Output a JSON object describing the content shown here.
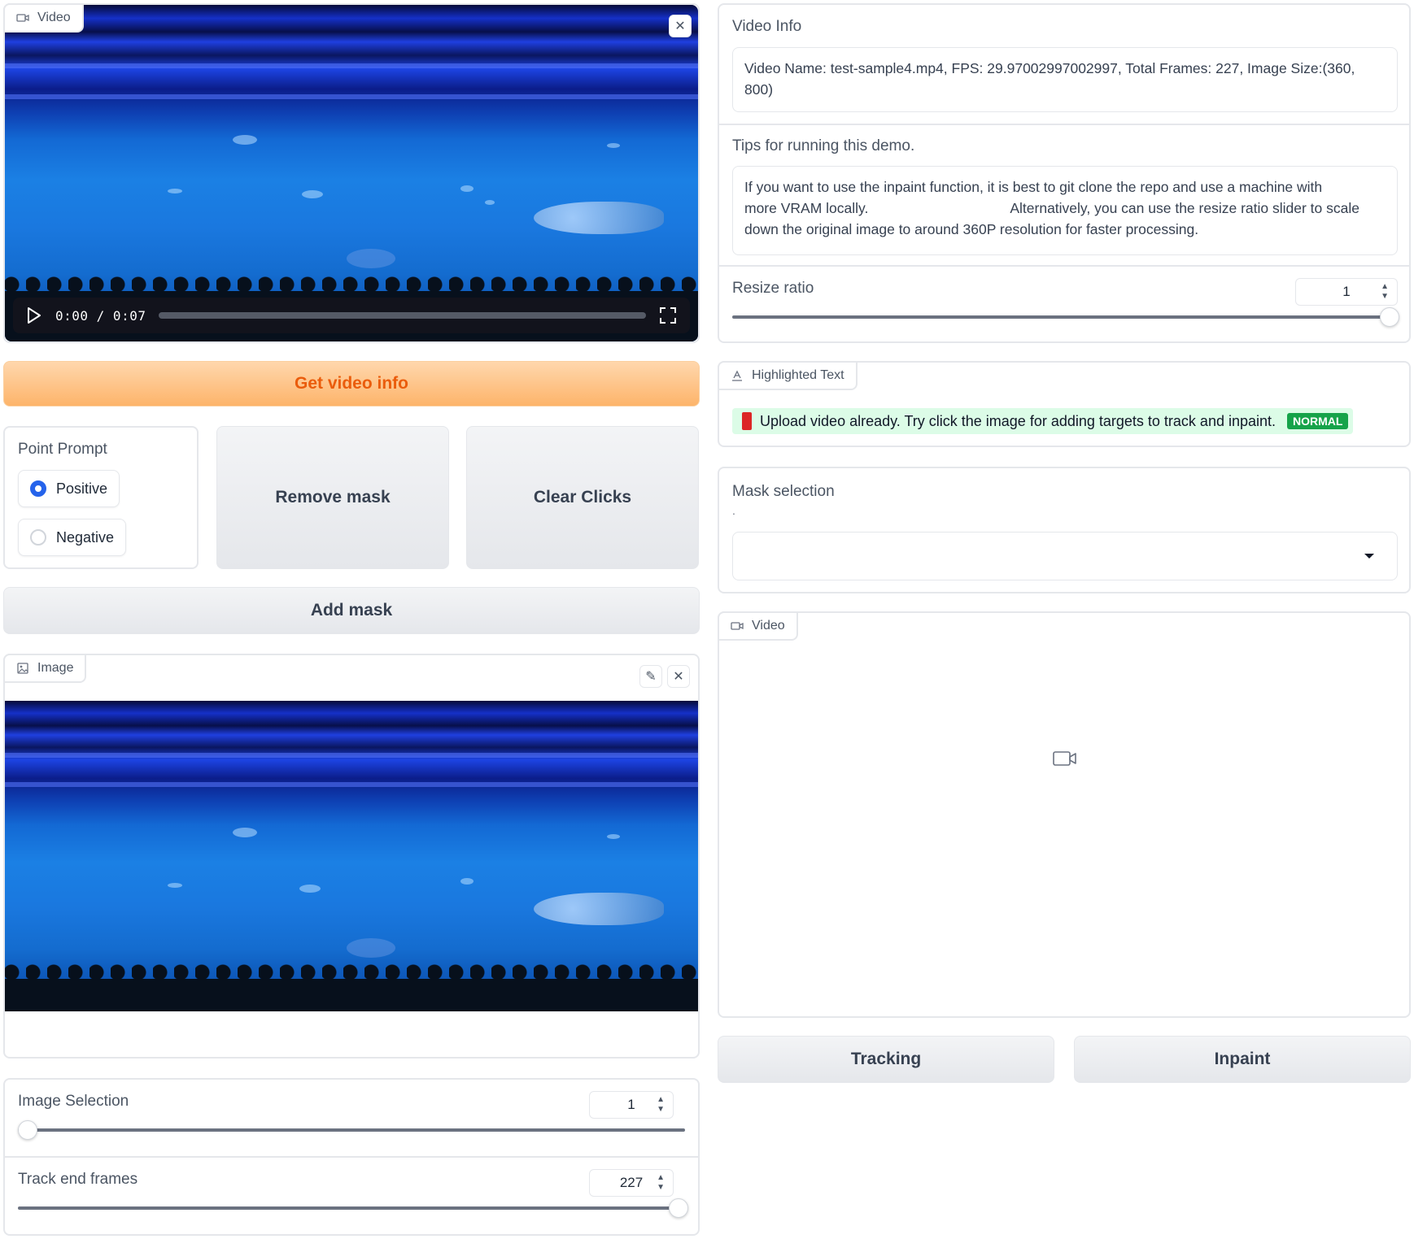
{
  "video_input": {
    "tag_label": "Video",
    "time_display": "0:00 / 0:07"
  },
  "buttons": {
    "get_video_info": "Get video info",
    "remove_mask": "Remove mask",
    "clear_clicks": "Clear Clicks",
    "add_mask": "Add mask",
    "tracking": "Tracking",
    "inpaint": "Inpaint"
  },
  "point_prompt": {
    "label": "Point Prompt",
    "options": [
      "Positive",
      "Negative"
    ],
    "selected": "Positive"
  },
  "image_panel": {
    "tag_label": "Image"
  },
  "image_selection": {
    "label": "Image Selection",
    "value": "1",
    "fraction": 0.0
  },
  "track_end_frames": {
    "label": "Track end frames",
    "value": "227",
    "fraction": 1.0
  },
  "video_info": {
    "label": "Video Info",
    "text": "Video Name: test-sample4.mp4, FPS: 29.97002997002997, Total Frames: 227, Image Size:(360, 800)"
  },
  "tips": {
    "label": "Tips for running this demo.",
    "line1": "If you want to use the inpaint function, it is best to git clone the repo and use a machine with",
    "line2a": "more VRAM locally.",
    "line2b": "Alternatively, you can use the resize ratio slider to scale",
    "line3": "down the original image to around 360P resolution for faster processing."
  },
  "resize_ratio": {
    "label": "Resize ratio",
    "value": "1",
    "fraction": 1.0
  },
  "highlighted_text": {
    "tag_label": "Highlighted Text",
    "message": "Upload video already. Try click the image for adding targets to track and inpaint.",
    "badge": "NORMAL",
    "badge_color": "#16a34a",
    "highlight_color": "#dcfce7",
    "marker_color": "#dc2626"
  },
  "mask_selection": {
    "label": "Mask selection",
    "sub": ".",
    "value": ""
  },
  "video_output": {
    "tag_label": "Video"
  },
  "accent": "#2563eb",
  "primary_button_text": "#ea5c0c"
}
